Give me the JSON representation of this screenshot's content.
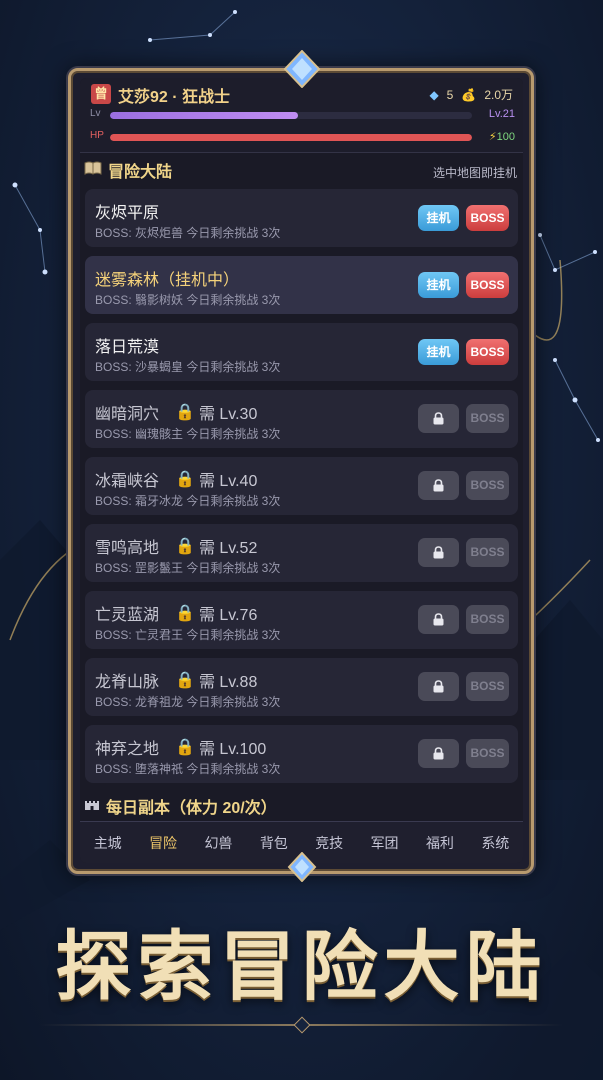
{
  "player": {
    "avatar_label": "曾",
    "name": "艾莎92 · 狂战士",
    "diamonds": "5",
    "gold": "2.0万",
    "lv_label": "Lv",
    "lv_value": "Lv.21",
    "lv_progress": 0.52,
    "hp_label": "HP",
    "hp_value": "100",
    "hp_progress": 1.0
  },
  "section": {
    "title": "冒险大陆",
    "hint": "选中地图即挂机"
  },
  "maps": [
    {
      "name": "灰烬平原",
      "boss": "BOSS: 灰烬炬兽   今日剩余挑战 3次",
      "locked": false,
      "active": false,
      "idle_label": "挂机",
      "boss_label": "BOSS"
    },
    {
      "name": "迷雾森林（挂机中）",
      "boss": "BOSS: 翳影树妖   今日剩余挑战 3次",
      "locked": false,
      "active": true,
      "idle_label": "挂机",
      "boss_label": "BOSS"
    },
    {
      "name": "落日荒漠",
      "boss": "BOSS: 沙暴蝎皇   今日剩余挑战 3次",
      "locked": false,
      "active": false,
      "idle_label": "挂机",
      "boss_label": "BOSS"
    },
    {
      "name": "幽暗洞穴",
      "req": "需 Lv.30",
      "boss": "BOSS: 幽瑰骸主   今日剩余挑战 3次",
      "locked": true,
      "boss_label": "BOSS"
    },
    {
      "name": "冰霜峡谷",
      "req": "需 Lv.40",
      "boss": "BOSS: 霜牙冰龙   今日剩余挑战 3次",
      "locked": true,
      "boss_label": "BOSS"
    },
    {
      "name": "雪鸣高地",
      "req": "需 Lv.52",
      "boss": "BOSS: 罡影鬣王   今日剩余挑战 3次",
      "locked": true,
      "boss_label": "BOSS"
    },
    {
      "name": "亡灵蓝湖",
      "req": "需 Lv.76",
      "boss": "BOSS: 亡灵君王   今日剩余挑战 3次",
      "locked": true,
      "boss_label": "BOSS"
    },
    {
      "name": "龙脊山脉",
      "req": "需 Lv.88",
      "boss": "BOSS: 龙脊祖龙   今日剩余挑战 3次",
      "locked": true,
      "boss_label": "BOSS"
    },
    {
      "name": "神弃之地",
      "req": "需 Lv.100",
      "boss": "BOSS: 堕落神祇   今日剩余挑战 3次",
      "locked": true,
      "boss_label": "BOSS"
    }
  ],
  "daily": {
    "title": "每日副本（体力 20/次）"
  },
  "tabs": [
    "主城",
    "冒险",
    "幻兽",
    "背包",
    "竞技",
    "军团",
    "福利",
    "系统"
  ],
  "active_tab": 1,
  "banner": "探索冒险大陆",
  "colors": {
    "gold_text": "#f0d58a",
    "idle_button": "#3a9bd8",
    "boss_button": "#cc3d3d",
    "lv_bar": "#9b6fe0",
    "hp_bar": "#e05555"
  },
  "icons": {
    "diamond": "diamond-icon",
    "gold": "money-bag-icon",
    "book": "book-icon",
    "lock": "lock-icon",
    "castle": "castle-icon",
    "lightning": "lightning-icon"
  }
}
